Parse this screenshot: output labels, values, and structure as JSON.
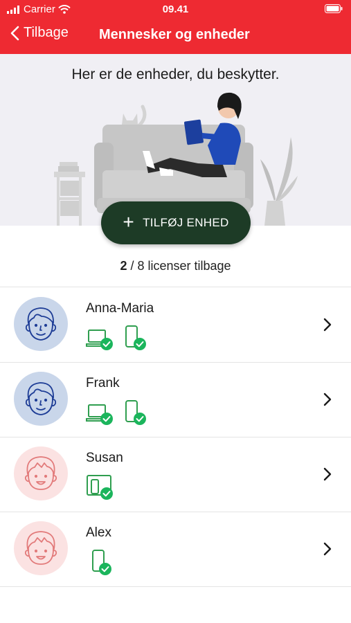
{
  "status_bar": {
    "carrier": "Carrier",
    "time": "09.41"
  },
  "nav": {
    "back_label": "Tilbage",
    "title": "Mennesker og enheder"
  },
  "hero": {
    "text": "Her er de enheder, du beskytter."
  },
  "add_button": {
    "label": "TILFØJ ENHED"
  },
  "licenses": {
    "used": "2",
    "rest": " / 8 licenser tilbage"
  },
  "colors": {
    "header": "#ee2a32",
    "button": "#1d3b26",
    "check": "#1bb55c",
    "device": "#2f9e4f"
  },
  "people": [
    {
      "name": "Anna-Maria",
      "avatar": "male-blue",
      "devices": [
        "laptop-check-icon",
        "phone-check-icon"
      ]
    },
    {
      "name": "Frank",
      "avatar": "male-blue",
      "devices": [
        "laptop-check-icon",
        "phone-check-icon"
      ]
    },
    {
      "name": "Susan",
      "avatar": "child-pink",
      "devices": [
        "tablet-phone-check-icon"
      ]
    },
    {
      "name": "Alex",
      "avatar": "child-pink",
      "devices": [
        "phone-check-icon"
      ]
    }
  ]
}
